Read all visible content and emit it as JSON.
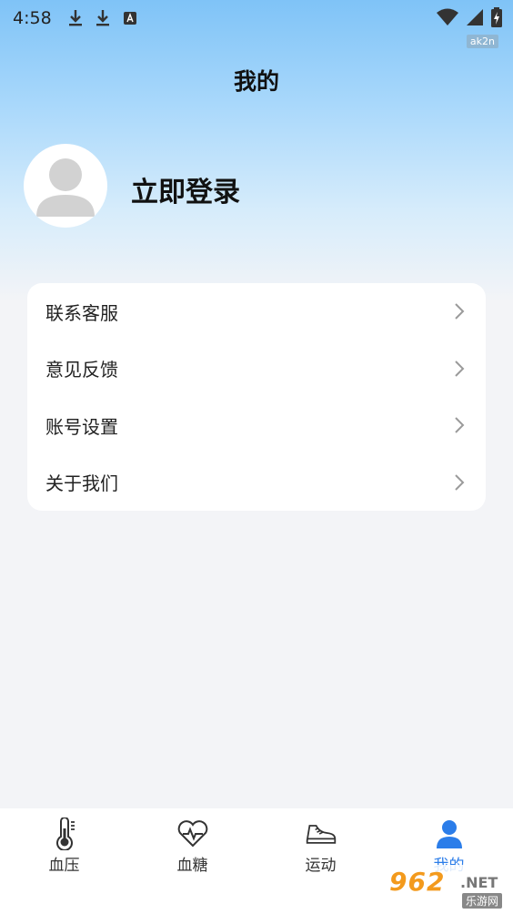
{
  "status_bar": {
    "time": "4:58",
    "debug_tag": "ak2n"
  },
  "header": {
    "title": "我的"
  },
  "profile": {
    "login_text": "立即登录"
  },
  "menu": {
    "items": [
      {
        "label": "联系客服"
      },
      {
        "label": "意见反馈"
      },
      {
        "label": "账号设置"
      },
      {
        "label": "关于我们"
      }
    ]
  },
  "tab_bar": {
    "tabs": [
      {
        "label": "血压",
        "icon": "thermometer-icon"
      },
      {
        "label": "血糖",
        "icon": "heart-pulse-icon"
      },
      {
        "label": "运动",
        "icon": "sneaker-icon"
      },
      {
        "label": "我的",
        "icon": "person-icon",
        "active": true
      }
    ],
    "active_color": "#2b7de9"
  },
  "watermark": {
    "main": "962",
    "net": ".NET",
    "sub": "乐游网"
  }
}
